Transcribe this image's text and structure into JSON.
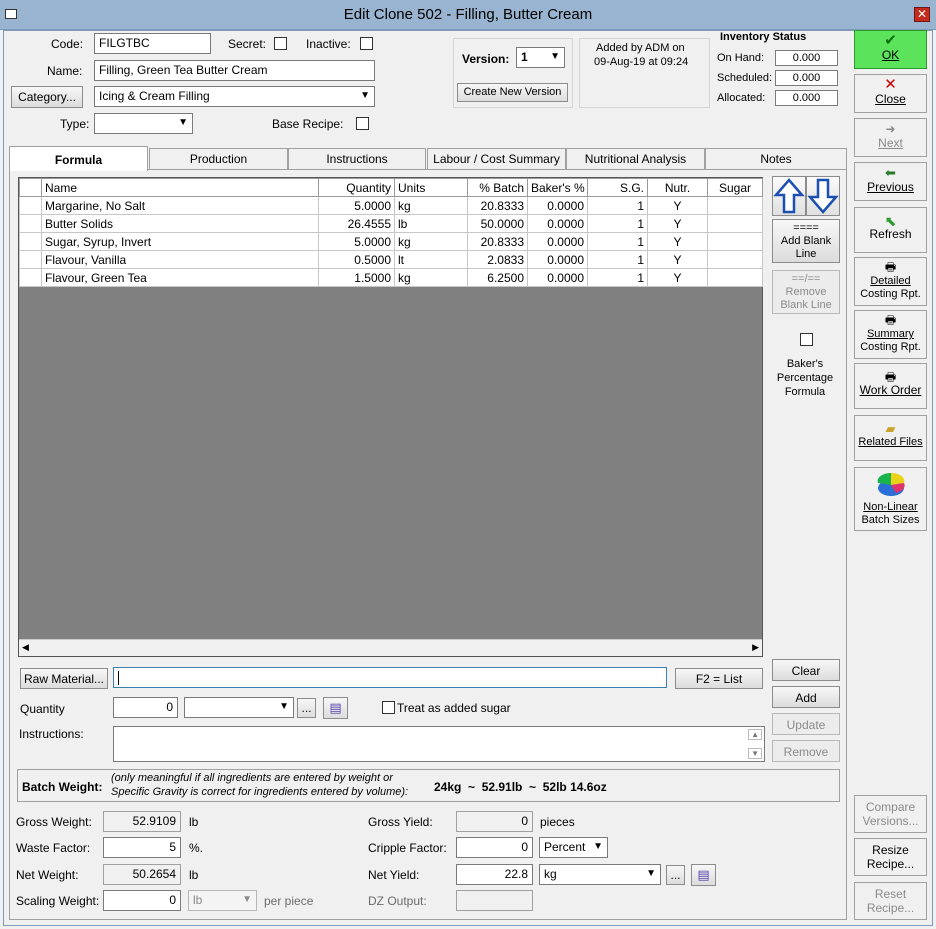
{
  "window": {
    "title": "Edit Clone 502 - Filling, Butter Cream"
  },
  "header": {
    "code_label": "Code:",
    "code_value": "FILGTBC",
    "secret_label": "Secret:",
    "inactive_label": "Inactive:",
    "name_label": "Name:",
    "name_value": "Filling, Green Tea Butter Cream",
    "category_button": "Category...",
    "category_value": "Icing & Cream Filling",
    "type_label": "Type:",
    "type_value": "",
    "base_recipe_label": "Base Recipe:"
  },
  "version": {
    "label": "Version:",
    "value": "1",
    "create_button": "Create New Version",
    "added_line1": "Added by ADM on",
    "added_line2": "09-Aug-19 at 09:24"
  },
  "inventory": {
    "title": "Inventory Status",
    "on_hand_label": "On Hand:",
    "on_hand": "0.000",
    "scheduled_label": "Scheduled:",
    "scheduled": "0.000",
    "allocated_label": "Allocated:",
    "allocated": "0.000"
  },
  "sidebar": {
    "ok": "OK",
    "close": "Close",
    "next": "Next",
    "previous": "Previous",
    "refresh": "Refresh",
    "detailed_1": "Detailed",
    "detailed_2": "Costing Rpt.",
    "summary_1": "Summary",
    "summary_2": "Costing Rpt.",
    "work_order": "Work Order",
    "related_files": "Related Files",
    "nonlinear_1": "Non-Linear",
    "nonlinear_2": "Batch Sizes",
    "compare_1": "Compare",
    "compare_2": "Versions...",
    "resize_1": "Resize",
    "resize_2": "Recipe...",
    "reset_1": "Reset",
    "reset_2": "Recipe..."
  },
  "tabs": [
    "Formula",
    "Production",
    "Instructions",
    "Labour / Cost Summary",
    "Nutritional Analysis",
    "Notes"
  ],
  "grid": {
    "columns": [
      "Name",
      "Quantity",
      "Units",
      "% Batch",
      "Baker's %",
      "S.G.",
      "Nutr.",
      "Sugar"
    ],
    "rows": [
      [
        "Margarine, No Salt",
        "5.0000",
        "kg",
        "20.8333",
        "0.0000",
        "1",
        "Y",
        ""
      ],
      [
        "Butter Solids",
        "26.4555",
        "lb",
        "50.0000",
        "0.0000",
        "1",
        "Y",
        ""
      ],
      [
        "Sugar, Syrup, Invert",
        "5.0000",
        "kg",
        "20.8333",
        "0.0000",
        "1",
        "Y",
        ""
      ],
      [
        "Flavour, Vanilla",
        "0.5000",
        "lt",
        "2.0833",
        "0.0000",
        "1",
        "Y",
        ""
      ],
      [
        "Flavour, Green Tea",
        "1.5000",
        "kg",
        "6.2500",
        "0.0000",
        "1",
        "Y",
        ""
      ]
    ]
  },
  "gridside": {
    "add_blank_eq": "====",
    "add_blank_1": "Add Blank",
    "add_blank_2": "Line",
    "remove_blank_eq": "==/==",
    "remove_blank_1": "Remove",
    "remove_blank_2": "Blank Line",
    "bakers_1": "Baker's",
    "bakers_2": "Percentage",
    "bakers_3": "Formula"
  },
  "entry": {
    "raw_material_button": "Raw Material...",
    "raw_material_value": "",
    "f2_button": "F2 = List",
    "clear": "Clear",
    "add": "Add",
    "update": "Update",
    "remove": "Remove",
    "quantity_label": "Quantity",
    "quantity_value": "0",
    "quantity_units": "",
    "ellipsis": "...",
    "treat_sugar_label": "Treat as added sugar",
    "instructions_label": "Instructions:"
  },
  "batch": {
    "label": "Batch Weight:",
    "note_1": "(only meaningful if all ingredients are entered by weight or",
    "note_2": "Specific Gravity is correct for ingredients entered by volume):",
    "value": "24kg  ~  52.91lb  ~  52lb 14.6oz"
  },
  "weights": {
    "gross_label": "Gross Weight:",
    "gross_value": "52.9109",
    "gross_unit": "lb",
    "waste_label": "Waste Factor:",
    "waste_value": "5",
    "waste_unit": "%.",
    "net_label": "Net Weight:",
    "net_value": "50.2654",
    "net_unit": "lb",
    "scaling_label": "Scaling Weight:",
    "scaling_value": "0",
    "scaling_unit": "lb",
    "per_piece": "per piece"
  },
  "yields": {
    "gross_label": "Gross Yield:",
    "gross_value": "0",
    "gross_unit": "pieces",
    "cripple_label": "Cripple Factor:",
    "cripple_value": "0",
    "cripple_unit": "Percent",
    "net_label": "Net Yield:",
    "net_value": "22.8",
    "net_unit": "kg",
    "dz_label": "DZ Output:",
    "dz_value": ""
  }
}
